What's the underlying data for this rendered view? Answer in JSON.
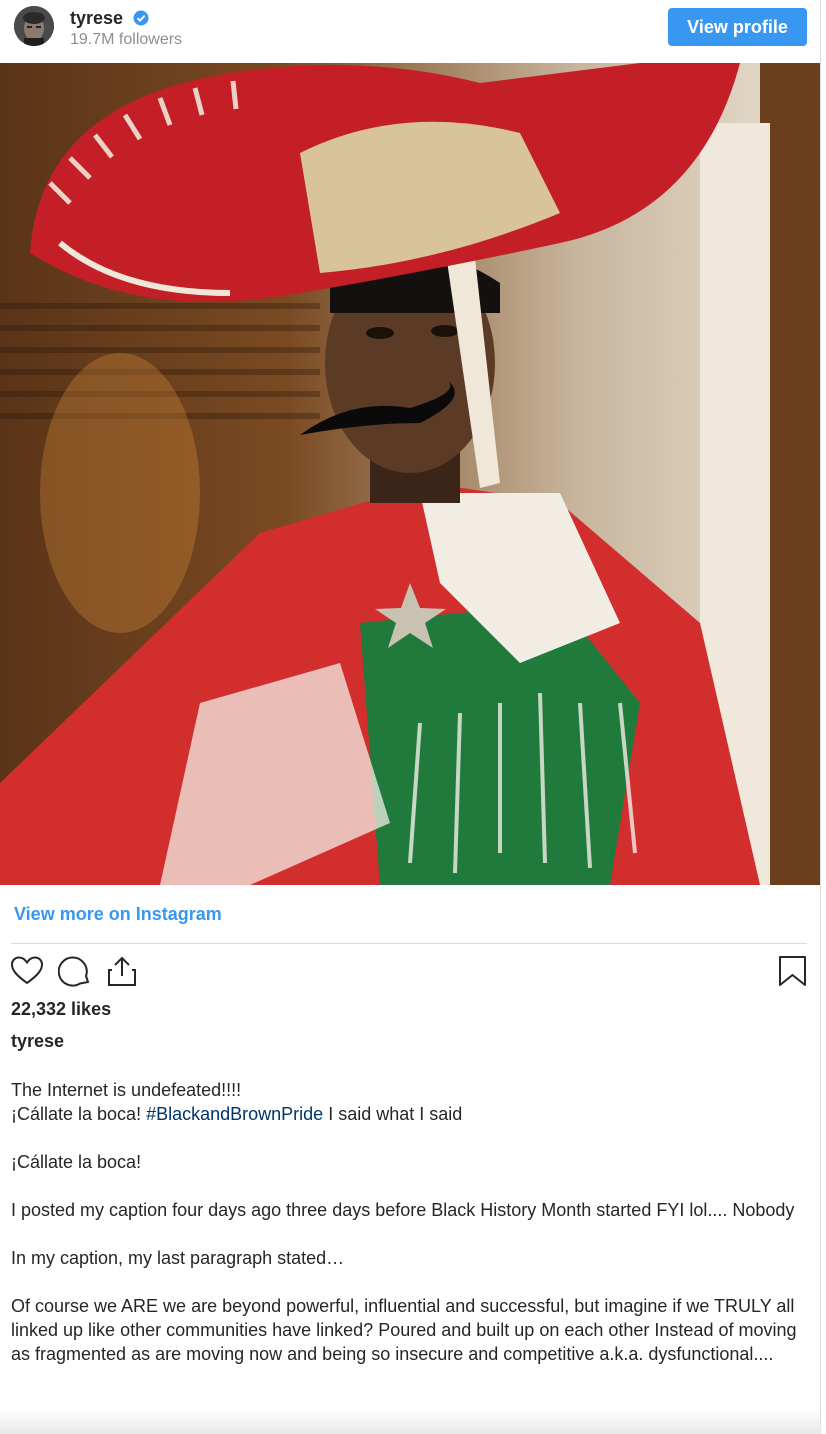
{
  "header": {
    "username": "tyrese",
    "followers": "19.7M followers",
    "view_profile_label": "View profile"
  },
  "colors": {
    "accent": "#3897f0",
    "hashtag": "#003569",
    "muted": "#8e8e8e"
  },
  "icons": {
    "verified": "verified-badge-icon",
    "like": "heart-icon",
    "comment": "comment-icon",
    "share": "share-icon",
    "save": "bookmark-icon"
  },
  "view_more_label": "View more on Instagram",
  "likes": "22,332 likes",
  "caption": {
    "username": "tyrese",
    "line1": "The Internet is undefeated!!!!",
    "line2_before": "¡Cállate la boca! ",
    "line2_hashtag": "#BlackandBrownPride",
    "line2_after": " I said what I said",
    "line3": "¡Cállate la boca!",
    "line4": "I posted my caption four days ago three days before Black History Month started FYI lol.... Nobody",
    "line5": "In my caption, my last paragraph stated…",
    "line6": "Of course we ARE we are beyond powerful, influential and successful, but imagine if we TRULY all linked up like other communities have linked? Poured and built up on each other Instead of moving as fragmented as are moving now and being so insecure and competitive a.k.a. dysfunctional...."
  }
}
